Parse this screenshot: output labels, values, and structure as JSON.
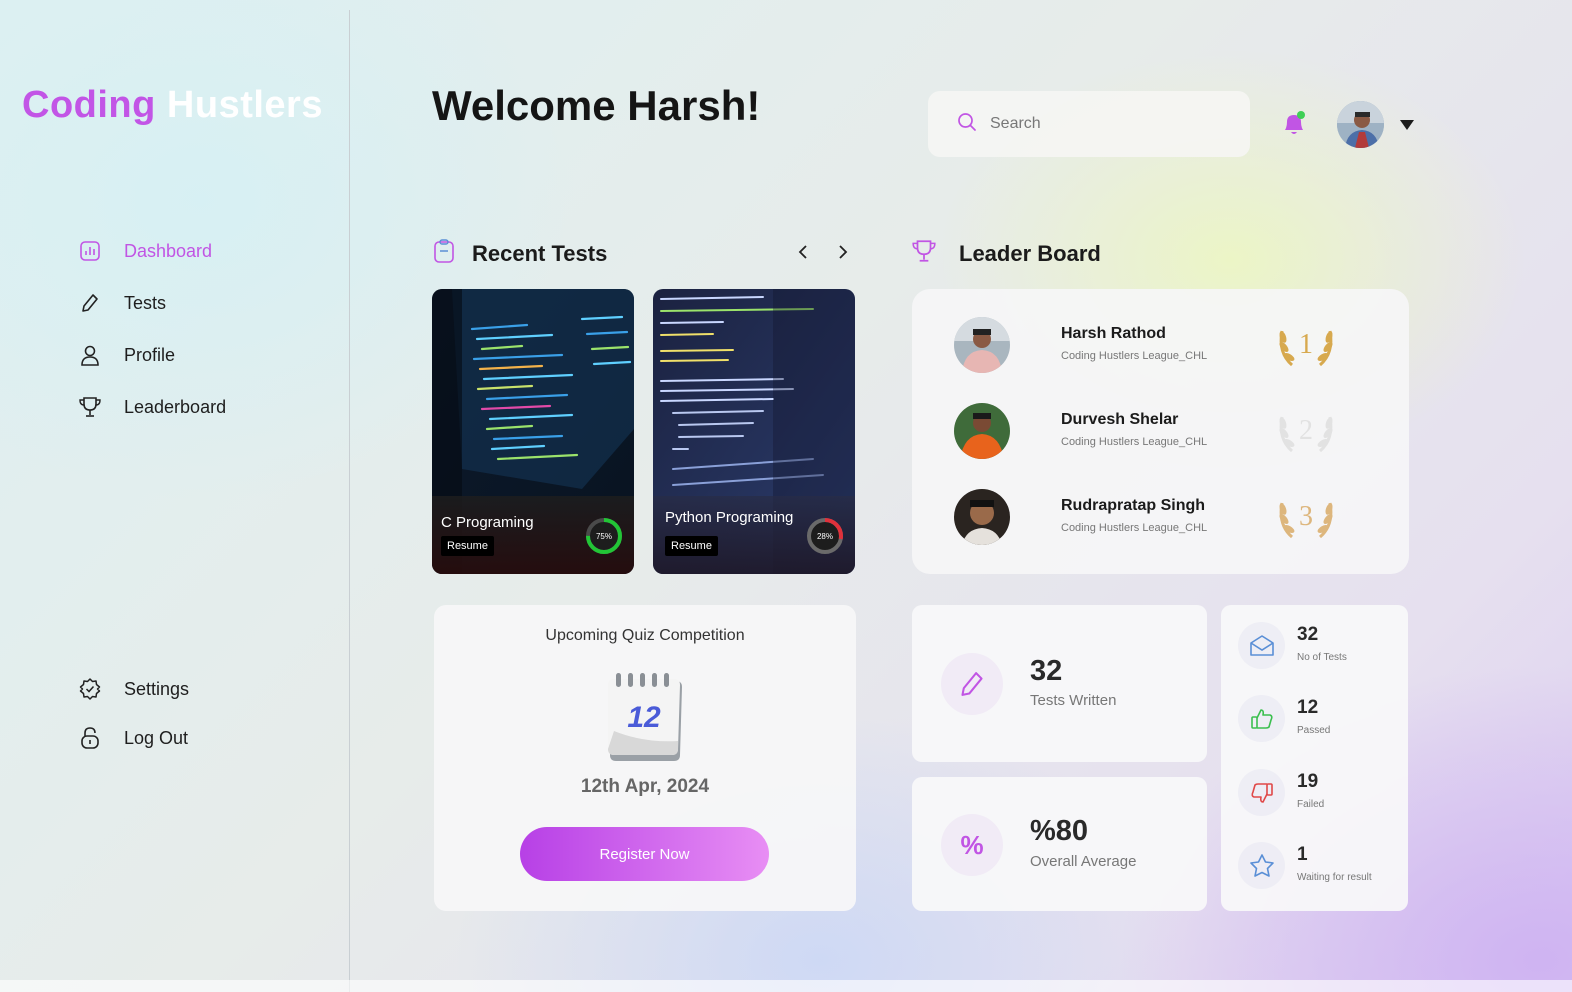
{
  "brand": {
    "part1": "Coding",
    "part2": "Hustlers"
  },
  "sidebar": {
    "items": [
      {
        "label": "Dashboard",
        "icon": "bar-chart-icon",
        "active": true
      },
      {
        "label": "Tests",
        "icon": "pencil-icon"
      },
      {
        "label": "Profile",
        "icon": "user-icon"
      },
      {
        "label": "Leaderboard",
        "icon": "trophy-icon"
      }
    ],
    "bottom": [
      {
        "label": "Settings",
        "icon": "settings-icon"
      },
      {
        "label": "Log Out",
        "icon": "logout-icon"
      }
    ]
  },
  "header": {
    "welcome": "Welcome Harsh!",
    "search_placeholder": "Search"
  },
  "recent_tests": {
    "title": "Recent Tests",
    "cards": [
      {
        "name": "C Programing",
        "button": "Resume",
        "progress_label": "75%",
        "progress": 0.75,
        "ring_color": "#22c536"
      },
      {
        "name": "Python Programing",
        "button": "Resume",
        "progress_label": "28%",
        "progress": 0.28,
        "ring_color": "#e0313b"
      }
    ]
  },
  "leaderboard": {
    "title": "Leader Board",
    "rows": [
      {
        "name": "Harsh Rathod",
        "league": "Coding Hustlers League_CHL",
        "rank": "1",
        "laurel_color": "#d7a94e"
      },
      {
        "name": "Durvesh Shelar",
        "league": "Coding Hustlers League_CHL",
        "rank": "2",
        "laurel_color": "#e2e2e2"
      },
      {
        "name": "Rudrapratap Singh",
        "league": "Coding Hustlers League_CHL",
        "rank": "3",
        "laurel_color": "#ddb67d"
      }
    ]
  },
  "quiz": {
    "title": "Upcoming Quiz Competition",
    "calendar_day": "12",
    "date": "12th Apr, 2024",
    "button": "Register Now"
  },
  "stats": {
    "tests_written": {
      "value": "32",
      "label": "Tests Written"
    },
    "overall_average": {
      "value": "%80",
      "label": "Overall Average",
      "symbol": "%"
    }
  },
  "summary": [
    {
      "value": "32",
      "label": "No of Tests",
      "icon": "envelope-icon",
      "color": "#5a8fd6"
    },
    {
      "value": "12",
      "label": "Passed",
      "icon": "thumbs-up-icon",
      "color": "#3bbf4f"
    },
    {
      "value": "19",
      "label": "Failed",
      "icon": "thumbs-down-icon",
      "color": "#e04848"
    },
    {
      "value": "1",
      "label": "Waiting for result",
      "icon": "star-icon",
      "color": "#5a8fd6"
    }
  ]
}
